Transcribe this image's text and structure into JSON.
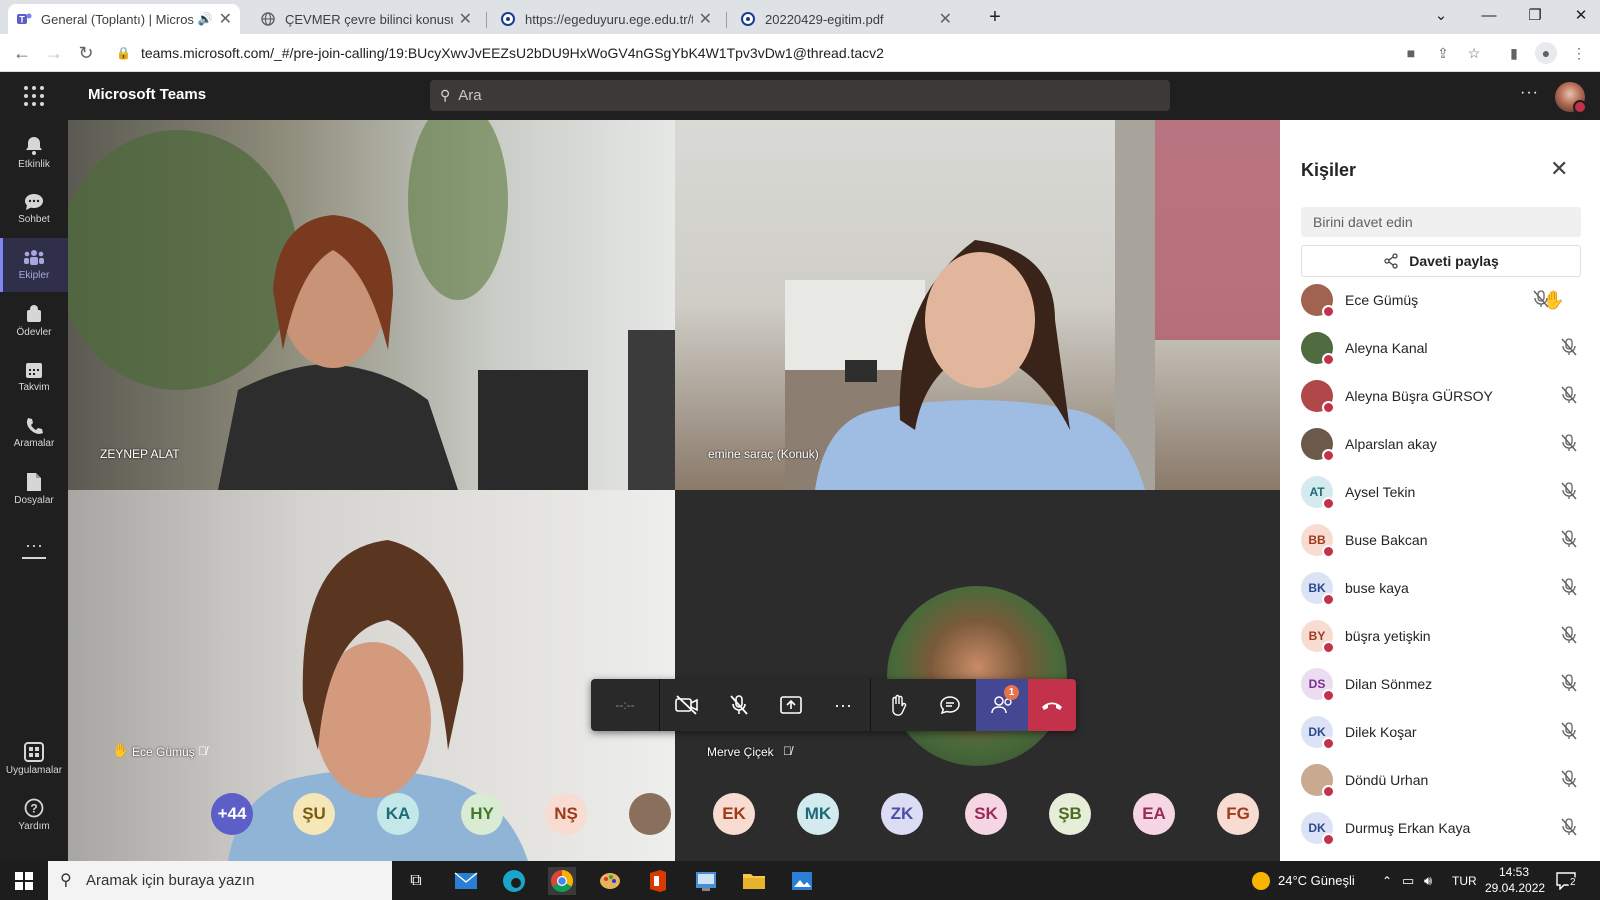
{
  "browser": {
    "tabs": [
      {
        "title": "General (Toplantı) | Microsoft Teams",
        "icon": "teams-icon"
      },
      {
        "title": "ÇEVMER çevre bilinci konusunda...",
        "icon": "globe-icon"
      },
      {
        "title": "https://egeduyuru.ege.edu.tr/tum...",
        "icon": "ege-icon"
      },
      {
        "title": "20220429-egitim.pdf",
        "icon": "ege-icon"
      }
    ],
    "url": "teams.microsoft.com/_#/pre-join-calling/19:BUcyXwvJvEEZsU2bDU9HxWoGV4nGSgYbK4W1Tpv3vDw1@thread.tacv2"
  },
  "teams": {
    "brand": "Microsoft Teams",
    "search_placeholder": "Ara",
    "rail": [
      {
        "label": "Etkinlik",
        "icon": "bell-icon"
      },
      {
        "label": "Sohbet",
        "icon": "chat-icon"
      },
      {
        "label": "Ekipler",
        "icon": "teams-icon"
      },
      {
        "label": "Ödevler",
        "icon": "assignments-icon"
      },
      {
        "label": "Takvim",
        "icon": "calendar-icon"
      },
      {
        "label": "Aramalar",
        "icon": "phone-icon"
      },
      {
        "label": "Dosyalar",
        "icon": "file-icon"
      },
      {
        "label": "Uygulamalar",
        "icon": "apps-icon"
      },
      {
        "label": "Yardım",
        "icon": "help-icon"
      }
    ]
  },
  "meeting": {
    "tiles": [
      {
        "name": "ZEYNEP ALAT"
      },
      {
        "name": "emine saraç (Konuk)"
      },
      {
        "name": "Ece Gümüş"
      },
      {
        "name": "Merve Çiçek"
      }
    ],
    "roster_bubbles": [
      {
        "text": "+44",
        "bg": "#5b5fc7",
        "fg": "#ffffff"
      },
      {
        "text": "ŞU",
        "bg": "#f6e7b9",
        "fg": "#7a5d0c"
      },
      {
        "text": "KA",
        "bg": "#c4e7ea",
        "fg": "#1c6b75"
      },
      {
        "text": "HY",
        "bg": "#d9ebd2",
        "fg": "#3f7a2c"
      },
      {
        "text": "NŞ",
        "bg": "#f8dcd2",
        "fg": "#a03a1a"
      },
      {
        "text": "",
        "bg": "#8a6f5c",
        "fg": "#ffffff"
      },
      {
        "text": "EK",
        "bg": "#f8dcd2",
        "fg": "#a03a1a"
      },
      {
        "text": "MK",
        "bg": "#d3eaef",
        "fg": "#1c6b75"
      },
      {
        "text": "ZK",
        "bg": "#dcdcf4",
        "fg": "#4b4fa6"
      },
      {
        "text": "SK",
        "bg": "#f6d6e3",
        "fg": "#9b2a57"
      },
      {
        "text": "ŞB",
        "bg": "#e6edd8",
        "fg": "#4d6b1e"
      },
      {
        "text": "EA",
        "bg": "#f6d6e3",
        "fg": "#9b2a57"
      },
      {
        "text": "FG",
        "bg": "#f8dcd2",
        "fg": "#a03a1a"
      }
    ],
    "controls": {
      "timer": "--:--",
      "people_badge": "1"
    }
  },
  "people_panel": {
    "title": "Kişiler",
    "invite_placeholder": "Birini davet edin",
    "share_label": "Daveti paylaş",
    "people": [
      {
        "name": "Ece Gümüş",
        "initials": "",
        "bg": "#a0634f",
        "fg": "#ffffff"
      },
      {
        "name": "Aleyna Kanal",
        "initials": "",
        "bg": "#4f6b3f",
        "fg": "#ffffff"
      },
      {
        "name": "Aleyna Büşra GÜRSOY",
        "initials": "",
        "bg": "#b0484a",
        "fg": "#ffffff"
      },
      {
        "name": "Alparslan akay",
        "initials": "",
        "bg": "#6b5a4a",
        "fg": "#ffffff"
      },
      {
        "name": "Aysel Tekin",
        "initials": "AT",
        "bg": "#d3eaef",
        "fg": "#1c6b75"
      },
      {
        "name": "Buse Bakcan",
        "initials": "BB",
        "bg": "#f8dcd2",
        "fg": "#a03a1a"
      },
      {
        "name": "buse kaya",
        "initials": "BK",
        "bg": "#dce3f4",
        "fg": "#2b4a8f"
      },
      {
        "name": "büşra yetişkin",
        "initials": "BY",
        "bg": "#f8dcd2",
        "fg": "#a03a1a"
      },
      {
        "name": "Dilan Sönmez",
        "initials": "DS",
        "bg": "#ebdcf1",
        "fg": "#7a2f91"
      },
      {
        "name": "Dilek Koşar",
        "initials": "DK",
        "bg": "#dce3f4",
        "fg": "#2b4a8f"
      },
      {
        "name": "Döndü Urhan",
        "initials": "",
        "bg": "#c9a98f",
        "fg": "#ffffff"
      },
      {
        "name": "Durmuş Erkan Kaya",
        "initials": "DK",
        "bg": "#dce3f4",
        "fg": "#2b4a8f"
      }
    ]
  },
  "taskbar": {
    "search_placeholder": "Aramak için buraya yazın",
    "weather": "24°C  Güneşli",
    "lang": "TUR",
    "time": "14:53",
    "date": "29.04.2022",
    "notif_count": "2"
  }
}
